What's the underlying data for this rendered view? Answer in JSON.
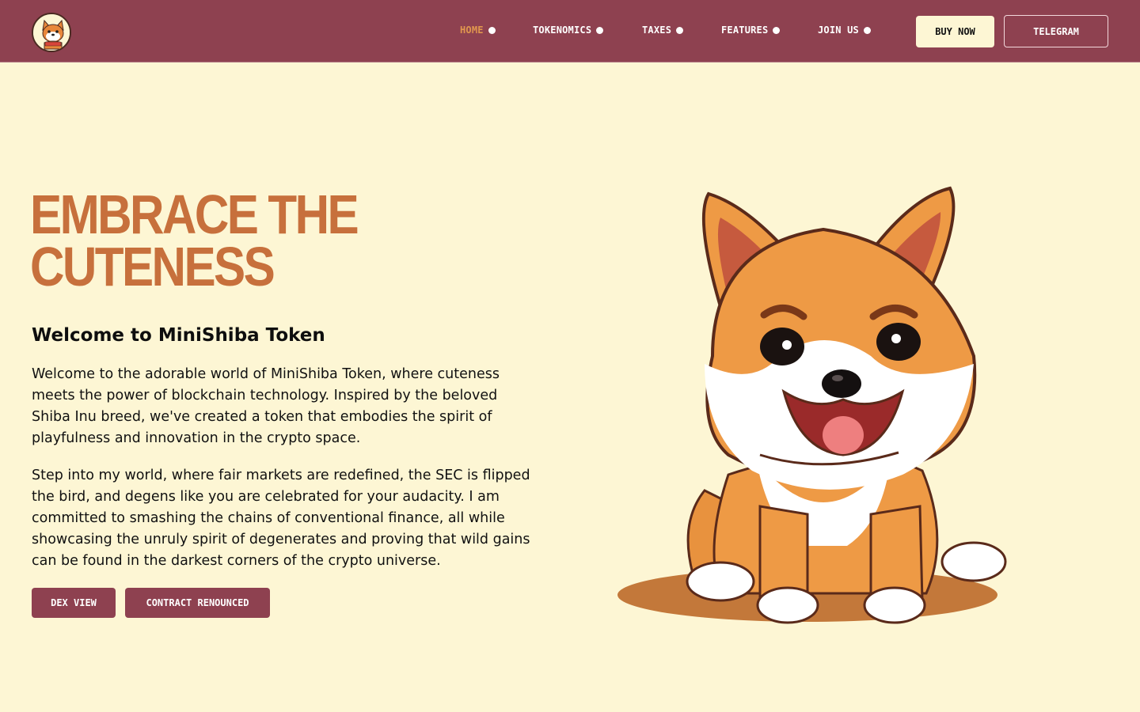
{
  "brand": {
    "logo_icon": "shiba-dog-logo-icon",
    "colors": {
      "nav_background": "#8e4150",
      "page_background": "#fdf6d4",
      "accent": "#c7703c",
      "active_nav": "#e0964e"
    }
  },
  "nav": {
    "items": [
      {
        "label": "HOME",
        "active": true
      },
      {
        "label": "TOKENOMICS",
        "active": false
      },
      {
        "label": "TAXES",
        "active": false
      },
      {
        "label": "FEATURES",
        "active": false
      },
      {
        "label": "JOIN US",
        "active": false
      }
    ],
    "buy_label": "BUY NOW",
    "telegram_label": "TELEGRAM"
  },
  "hero": {
    "title_line1": "EMBRACE THE",
    "title_line2": "CUTENESS",
    "subtitle": "Welcome to MiniShiba Token",
    "paragraph1": "Welcome to the adorable world of MiniShiba Token, where cuteness meets the power of blockchain technology. Inspired by the beloved Shiba Inu breed, we've created a token that embodies the spirit of playfulness and innovation in the crypto space.",
    "paragraph2": "Step into my world, where fair markets are redefined, the SEC is flipped the bird, and degens like you are celebrated for your audacity. I am committed to smashing the chains of conventional finance, all while showcasing the unruly spirit of degenerates and proving that wild gains can be found in the darkest corners of the crypto universe.",
    "dex_label": "DEX VIEW",
    "contract_label": "CONTRACT RENOUNCED",
    "mascot_icon": "shiba-inu-puppy-illustration"
  }
}
